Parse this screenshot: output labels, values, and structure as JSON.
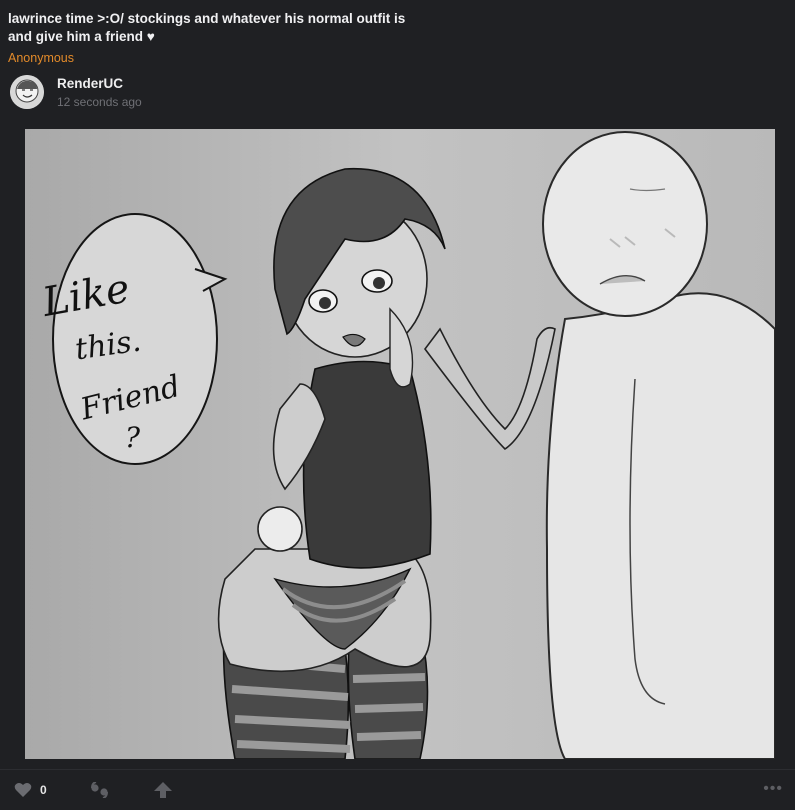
{
  "post": {
    "title": "lawrince time >:O/ stockings and whatever his normal outfit is and give him a friend ♥",
    "requester": "Anonymous"
  },
  "author": {
    "name": "RenderUC",
    "time": "12 seconds ago"
  },
  "artwork": {
    "speech_line1": "Like",
    "speech_line2": "this.",
    "speech_line3": "Friend",
    "speech_line4": "?"
  },
  "footer": {
    "like_icon": "heart-icon",
    "like_count": "0",
    "quote_icon": "quote-icon",
    "boost_icon": "boost-arrow-icon",
    "more_label": "•••"
  },
  "colors": {
    "background": "#1f2023",
    "requester": "#e28a2a",
    "muted": "#6f7075"
  }
}
